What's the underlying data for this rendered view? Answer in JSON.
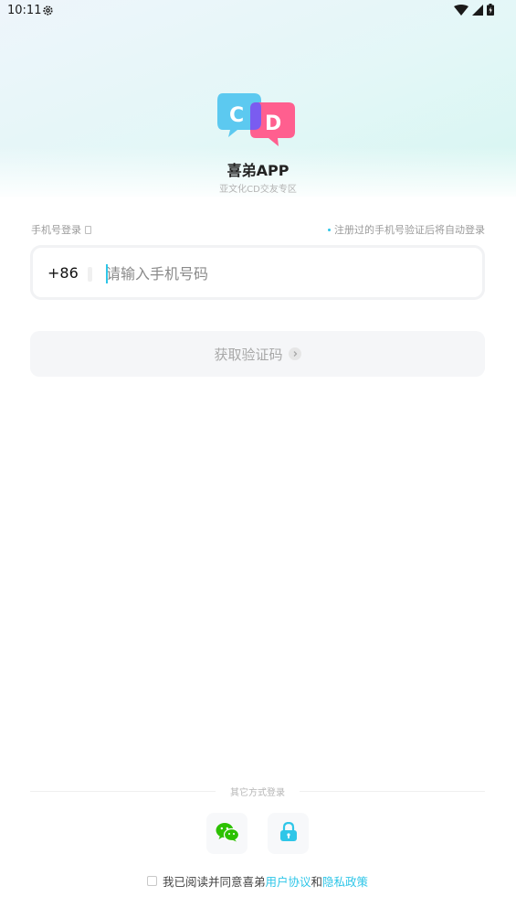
{
  "status_bar": {
    "time": "10:11"
  },
  "app": {
    "name": "喜弟APP",
    "slogan": "亚文化CD交友专区"
  },
  "login": {
    "label": "手机号登录",
    "auto_register_note": "注册过的手机号验证后将自动登录",
    "country_code": "+86",
    "phone_placeholder": "请输入手机号码",
    "get_code_button": "获取验证码"
  },
  "other_login": {
    "title": "其它方式登录",
    "methods": [
      "wechat-icon",
      "lock-icon"
    ]
  },
  "agreement": {
    "prefix": "我已阅读并同意喜弟",
    "user_agreement": "用户协议",
    "and": "和",
    "privacy_policy": "隐私政策"
  },
  "colors": {
    "accent": "#2ec6e8",
    "logo_blue": "#5cc9f0",
    "logo_pink": "#ff5f8f",
    "wechat_green": "#2dc100"
  }
}
